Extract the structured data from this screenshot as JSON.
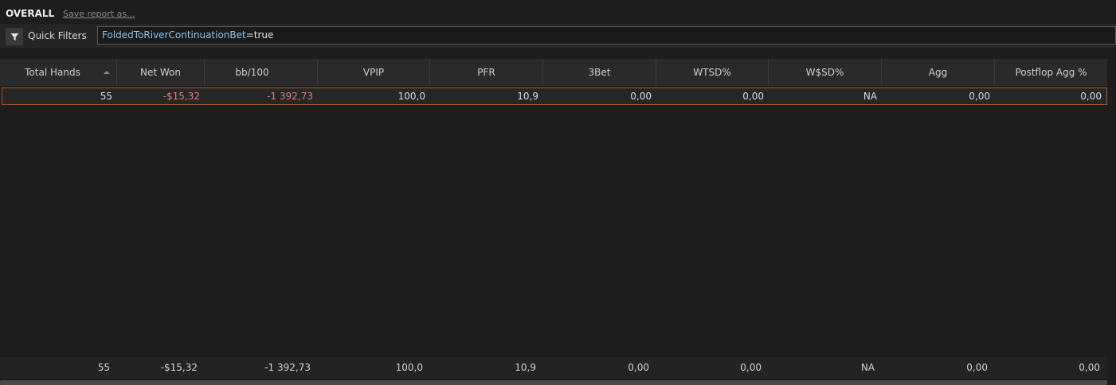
{
  "header": {
    "title": "OVERALL",
    "save_link": "Save report as..."
  },
  "filters": {
    "label": "Quick Filters",
    "keyword": "FoldedToRiverContinuationBet",
    "operator_value": "=true"
  },
  "columns": [
    "Total Hands",
    "Net Won",
    "bb/100",
    "VPIP",
    "PFR",
    "3Bet",
    "WTSD%",
    "W$SD%",
    "Agg",
    "Postflop Agg %"
  ],
  "rows": [
    [
      "55",
      "-$15,32",
      "-1 392,73",
      "100,0",
      "10,9",
      "0,00",
      "0,00",
      "NA",
      "0,00",
      "0,00"
    ]
  ],
  "totals": [
    "55",
    "-$15,32",
    "-1 392,73",
    "100,0",
    "10,9",
    "0,00",
    "0,00",
    "NA",
    "0,00",
    "0,00"
  ],
  "colors": {
    "negative": "#e0817a",
    "selection_border": "#a25c2a",
    "link_keyword": "#8fc2ec"
  },
  "icons": {
    "filter": "funnel-icon",
    "sort": "sort-ascending-icon"
  }
}
